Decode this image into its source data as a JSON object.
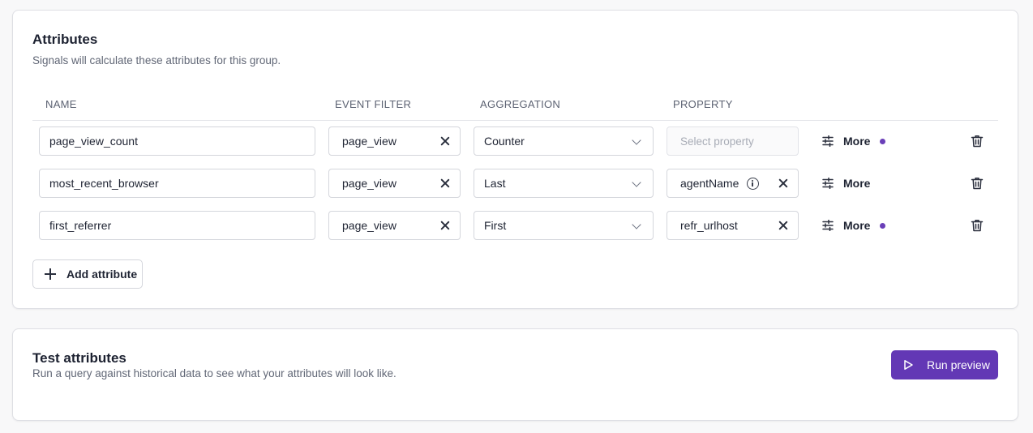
{
  "attributes": {
    "title": "Attributes",
    "subtitle": "Signals will calculate these attributes for this group.",
    "columns": {
      "name": "NAME",
      "event_filter": "EVENT FILTER",
      "aggregation": "AGGREGATION",
      "property": "PROPERTY"
    },
    "rows": [
      {
        "name": "page_view_count",
        "event_filter": "page_view",
        "aggregation": "Counter",
        "property": "",
        "property_placeholder": "Select property",
        "more_label": "More",
        "has_indicator": true
      },
      {
        "name": "most_recent_browser",
        "event_filter": "page_view",
        "aggregation": "Last",
        "property": "agentName",
        "more_label": "More",
        "has_indicator": false
      },
      {
        "name": "first_referrer",
        "event_filter": "page_view",
        "aggregation": "First",
        "property": "refr_urlhost",
        "more_label": "More",
        "has_indicator": true
      }
    ],
    "add_button_label": "Add attribute"
  },
  "test": {
    "title": "Test attributes",
    "subtitle": "Run a query against historical data to see what your attributes will look like.",
    "run_button_label": "Run preview"
  },
  "colors": {
    "accent": "#6338b5",
    "indicator": "#6a3fb8",
    "border": "#d4d6dc",
    "text": "#1f2433",
    "muted": "#616776"
  },
  "icons": {
    "clear": "close-icon",
    "dropdown": "chevron-down-icon",
    "info": "info-icon",
    "more": "sliders-icon",
    "delete": "trash-icon",
    "add": "plus-icon",
    "run": "play-icon"
  }
}
